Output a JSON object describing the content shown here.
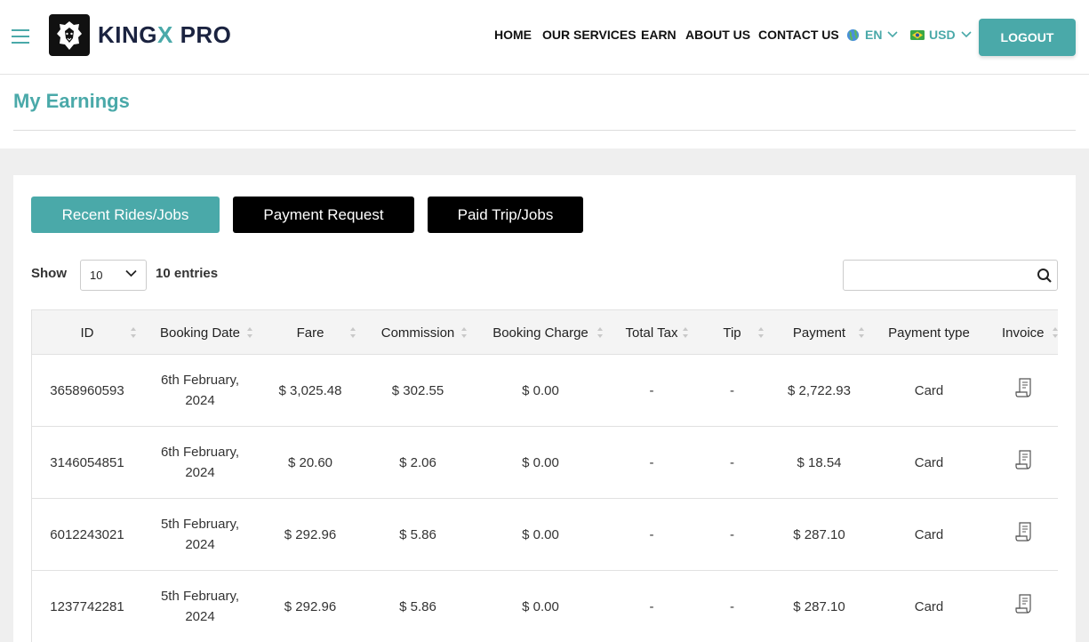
{
  "header": {
    "brand": {
      "part1": "KING",
      "part2": "X",
      "part3": " PRO"
    },
    "nav": [
      {
        "label": "HOME"
      },
      {
        "label": "OUR SERVICES"
      },
      {
        "label": "EARN"
      },
      {
        "label": "ABOUT US"
      },
      {
        "label": "CONTACT US"
      }
    ],
    "language": {
      "label": "EN",
      "icon": "globe-icon"
    },
    "currency": {
      "label": "USD",
      "icon": "flag-icon"
    },
    "logout_label": "LOGOUT",
    "accent_color": "#4aa9a9"
  },
  "page": {
    "title": "My Earnings"
  },
  "tabs": [
    {
      "label": "Recent Rides/Jobs",
      "active": true
    },
    {
      "label": "Payment Request",
      "active": false
    },
    {
      "label": "Paid Trip/Jobs",
      "active": false
    }
  ],
  "controls": {
    "show_label": "Show",
    "entries_value": "10",
    "entries_label": "10 entries",
    "search_value": ""
  },
  "table": {
    "columns": [
      "ID",
      "Booking Date",
      "Fare",
      "Commission",
      "Booking Charge",
      "Total Tax",
      "Tip",
      "Payment",
      "Payment type",
      "Invoice"
    ],
    "rows": [
      {
        "id": "3658960593",
        "date1": "6th February,",
        "date2": "2024",
        "fare": "$ 3,025.48",
        "commission": "$ 302.55",
        "booking_charge": "$ 0.00",
        "total_tax": "-",
        "tip": "-",
        "payment": "$ 2,722.93",
        "payment_type": "Card"
      },
      {
        "id": "3146054851",
        "date1": "6th February,",
        "date2": "2024",
        "fare": "$ 20.60",
        "commission": "$ 2.06",
        "booking_charge": "$ 0.00",
        "total_tax": "-",
        "tip": "-",
        "payment": "$ 18.54",
        "payment_type": "Card"
      },
      {
        "id": "6012243021",
        "date1": "5th February,",
        "date2": "2024",
        "fare": "$ 292.96",
        "commission": "$ 5.86",
        "booking_charge": "$ 0.00",
        "total_tax": "-",
        "tip": "-",
        "payment": "$ 287.10",
        "payment_type": "Card"
      },
      {
        "id": "1237742281",
        "date1": "5th February,",
        "date2": "2024",
        "fare": "$ 292.96",
        "commission": "$ 5.86",
        "booking_charge": "$ 0.00",
        "total_tax": "-",
        "tip": "-",
        "payment": "$ 287.10",
        "payment_type": "Card"
      }
    ]
  }
}
